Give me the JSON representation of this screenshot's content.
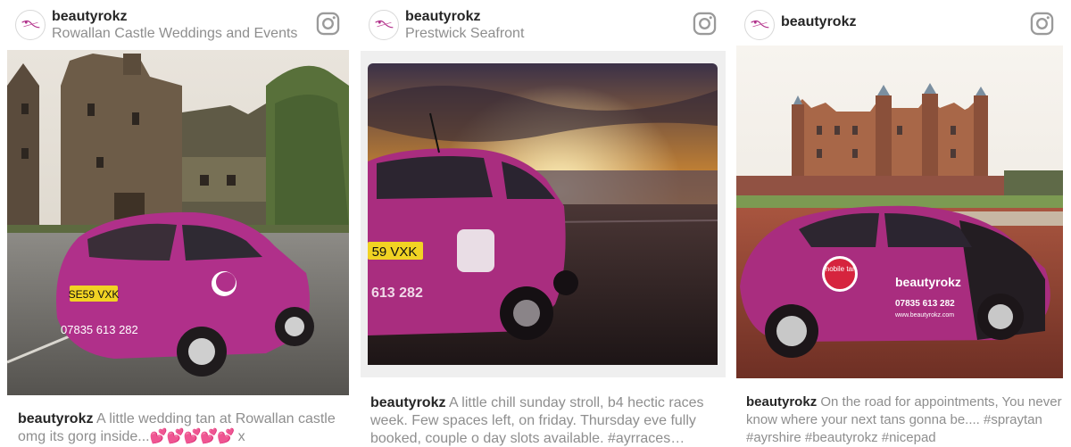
{
  "posts": [
    {
      "username": "beautyrokz",
      "location": "Rowallan Castle Weddings and Events",
      "caption_user": "beautyrokz",
      "caption_text": "A little wedding tan at Rowallan castle omg its gorg inside...",
      "caption_emoji": "💕💕💕💕💕",
      "caption_end": " x",
      "plate": "SE59 VXK",
      "car_phone": "07835 613 282"
    },
    {
      "username": "beautyrokz",
      "location": "Prestwick Seafront",
      "caption_user": "beautyrokz",
      "caption_text": "A little chill sunday stroll, b4 hectic races week. Few spaces left, on friday. Thursday eve fully booked, couple o day slots available. #ayrraces…",
      "plate": "59 VXK",
      "car_phone": "613 282"
    },
    {
      "username": "beautyrokz",
      "location": "",
      "caption_user": "beautyrokz",
      "caption_text": "On the road for appointments, You never know where your next tans gonna be.... #spraytan #ayrshire #beautyrokz #nicepad",
      "car_badge": "mobile tan",
      "car_brand": "beautyrokz",
      "car_phone": "07835 613 282",
      "car_web": "www.beautyrokz.com"
    }
  ],
  "colors": {
    "car_pink": "#b0308a",
    "text_dark": "#262626",
    "text_gray": "#8e8e8e"
  },
  "icons": {
    "avatar": "beautyrokz-logo",
    "instagram": "instagram-icon"
  }
}
